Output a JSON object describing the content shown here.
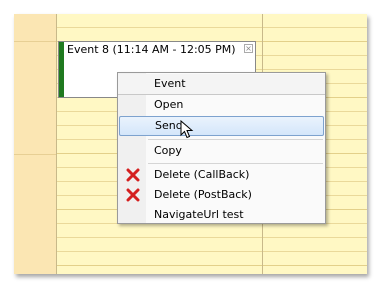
{
  "event": {
    "title": "Event 8 (11:14 AM - 12:05 PM)",
    "close_glyph": "×",
    "bar_color": "#1f7a1f"
  },
  "context_menu": {
    "header": "Event",
    "items": [
      {
        "label": "Open",
        "icon": null
      },
      {
        "label": "Send",
        "icon": null,
        "hovered": true
      },
      {
        "label": "Copy",
        "icon": null
      },
      {
        "label": "Delete (CallBack)",
        "icon": "red-x-icon"
      },
      {
        "label": "Delete (PostBack)",
        "icon": "red-x-icon"
      },
      {
        "label": "NavigateUrl test",
        "icon": null
      }
    ]
  },
  "colors": {
    "calendar_background": "#fff8c4",
    "hour_column": "#fbe6b3",
    "hover_border": "#7da2ce",
    "delete_icon": "#d42020"
  }
}
